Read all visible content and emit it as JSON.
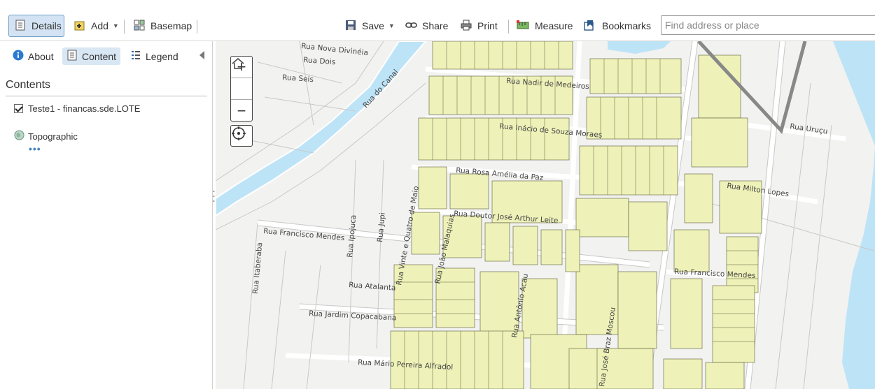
{
  "toolbar": {
    "details_label": "Details",
    "add_label": "Add",
    "basemap_label": "Basemap",
    "save_label": "Save",
    "share_label": "Share",
    "print_label": "Print",
    "measure_label": "Measure",
    "bookmarks_label": "Bookmarks",
    "search_placeholder": "Find address or place"
  },
  "sidebar": {
    "tabs": [
      {
        "label": "About",
        "icon": "info-icon",
        "active": false
      },
      {
        "label": "Content",
        "icon": "content-icon",
        "active": true
      },
      {
        "label": "Legend",
        "icon": "legend-icon",
        "active": false
      }
    ],
    "contents_title": "Contents",
    "layer": {
      "label": "Teste1 - financas.sde.LOTE",
      "checked": true
    },
    "basemap": {
      "label": "Topographic"
    },
    "more_label": "•••"
  },
  "map": {
    "zoom_in": "+",
    "zoom_out": "−",
    "streets": [
      "Rua Nova Divinéia",
      "Rua Dois",
      "Rua Seis",
      "Rua do Canal",
      "Rua Nadir de Medeiros",
      "Rua Inácio de Souza Moraes",
      "Rua Rosa Amélia da Paz",
      "Rua Doutor José Arthur Leite",
      "Rua Francisco Mendes",
      "Rua Ipojuca",
      "Rua Jupi",
      "Rua Vinte e Quatro de Maio",
      "Rua João Malaquias",
      "Rua Itaberaba",
      "Rua Atalanta",
      "Rua Jardim Copacabana",
      "Rua Mário Pereira Alfradol",
      "Rua Antônio Acau",
      "Rua José Braz Moscou",
      "Rua Uruçu",
      "Rua Milton Lopes",
      "Rua Francisco Mendes"
    ],
    "colors": {
      "parcel": "#eef2b8",
      "water": "#bde3f7",
      "road": "#ffffff",
      "land": "#f2f2f0",
      "boundary": "#888888"
    }
  }
}
